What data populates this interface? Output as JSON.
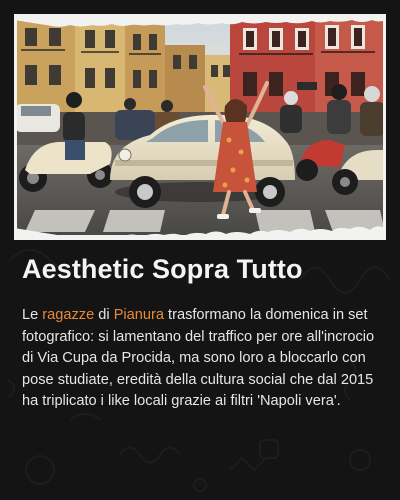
{
  "article": {
    "title": "Aesthetic Sopra Tutto",
    "body": {
      "intro": "Le ",
      "keyword_1": "ragazze",
      "connector": " di ",
      "keyword_2": "Pianura",
      "rest": " trasformano la domenica in set fotografico: si lamentano del traffico per ore all'incrocio di Via Cupa da Procida, ma sono loro a bloccarlo con pose studiate, eredità della cultura social che dal 2015 ha triplicato i like locali grazie ai filtri 'Napoli vera'."
    }
  },
  "hero_image": {
    "subject": "street-scene-woman-posing-in-traffic-with-scooters-and-fiat-500"
  },
  "colors": {
    "background": "#141414",
    "accent": "#e8893a",
    "title": "#f4f4f4",
    "body_text": "#e6e6e6",
    "frame": "#f2f2f0"
  }
}
